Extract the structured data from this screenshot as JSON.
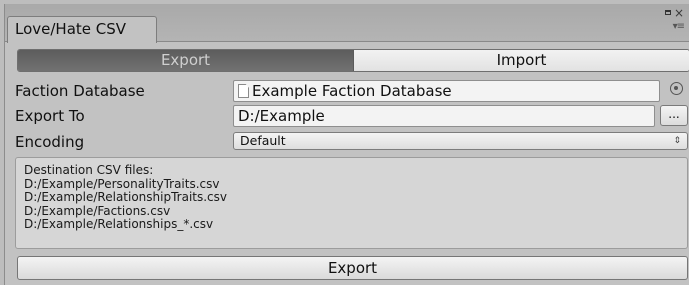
{
  "window": {
    "tab_title": "Love/Hate CSV",
    "controls": {
      "maximize_icon": "maximize-icon",
      "close_glyph": "×",
      "menu_glyph": "▾≡"
    }
  },
  "toolbar": {
    "export_label": "Export",
    "import_label": "Import",
    "selected": "Export"
  },
  "form": {
    "faction_database": {
      "label": "Faction Database",
      "value": "Example Faction Database"
    },
    "export_to": {
      "label": "Export To",
      "value": "D:/Example",
      "browse_label": "..."
    },
    "encoding": {
      "label": "Encoding",
      "value": "Default",
      "arrows": "⇕"
    }
  },
  "help": {
    "lines": [
      "Destination CSV files:",
      "D:/Example/PersonalityTraits.csv",
      "D:/Example/RelationshipTraits.csv",
      "D:/Example/Factions.csv",
      "D:/Example/Relationships_*.csv"
    ]
  },
  "actions": {
    "export_button_label": "Export"
  }
}
